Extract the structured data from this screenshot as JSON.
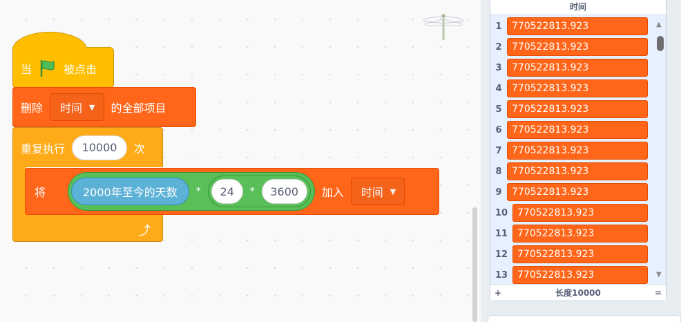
{
  "blocks": {
    "hat": {
      "when_label": "当",
      "clicked_label": "被点击",
      "flag_icon": "green-flag-icon"
    },
    "delete_all": {
      "label_prefix": "删除",
      "list_name": "时间",
      "label_suffix": "的全部项目"
    },
    "repeat": {
      "label": "重复执行",
      "count": "10000",
      "suffix": "次"
    },
    "add_to_list": {
      "label": "将",
      "days_reporter": "2000年至今的天数",
      "op1": "*",
      "num_a": "24",
      "op2": "*",
      "num_b": "3600",
      "add_label": "加入",
      "list_name": "时间"
    }
  },
  "list_monitor": {
    "title": "时间",
    "items": [
      {
        "index": "1",
        "value": "770522813.923"
      },
      {
        "index": "2",
        "value": "770522813.923"
      },
      {
        "index": "3",
        "value": "770522813.923"
      },
      {
        "index": "4",
        "value": "770522813.923"
      },
      {
        "index": "5",
        "value": "770522813.923"
      },
      {
        "index": "6",
        "value": "770522813.923"
      },
      {
        "index": "7",
        "value": "770522813.923"
      },
      {
        "index": "8",
        "value": "770522813.923"
      },
      {
        "index": "9",
        "value": "770522813.923"
      },
      {
        "index": "10",
        "value": "770522813.923"
      },
      {
        "index": "11",
        "value": "770522813.923"
      },
      {
        "index": "12",
        "value": "770522813.923"
      },
      {
        "index": "13",
        "value": "770522813.923"
      }
    ],
    "add_button": "+",
    "length_label": "长度10000",
    "resize_handle": "="
  },
  "colors": {
    "events": "#ffbf00",
    "data": "#ff661a",
    "control": "#ffab19",
    "operators": "#59c059",
    "sensing": "#5cb1d6"
  }
}
